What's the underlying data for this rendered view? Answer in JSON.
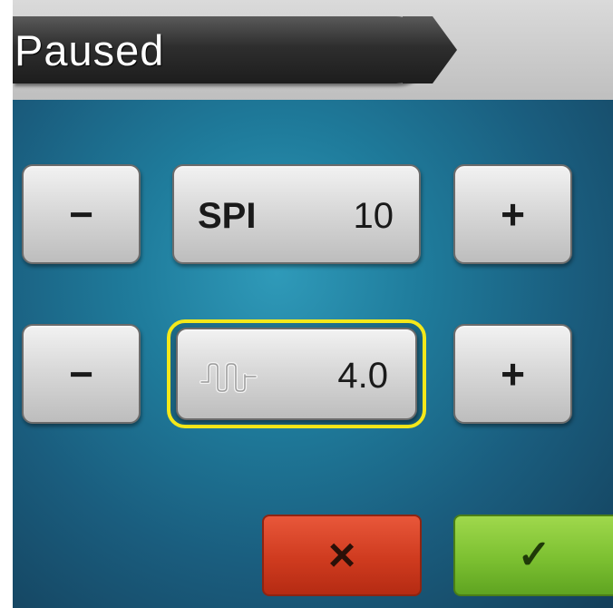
{
  "header": {
    "title": "Paused"
  },
  "spi_row": {
    "minus_label": "−",
    "label": "SPI",
    "value": "10",
    "plus_label": "+"
  },
  "length_row": {
    "minus_label": "−",
    "icon": "stitch-length-icon",
    "value": "4.0",
    "plus_label": "+",
    "selected": true
  },
  "actions": {
    "cancel_label": "×",
    "confirm_label": "✓"
  },
  "colors": {
    "focus_ring": "#f4e81a",
    "cancel": "#cf3b1f",
    "confirm": "#7cc031"
  }
}
